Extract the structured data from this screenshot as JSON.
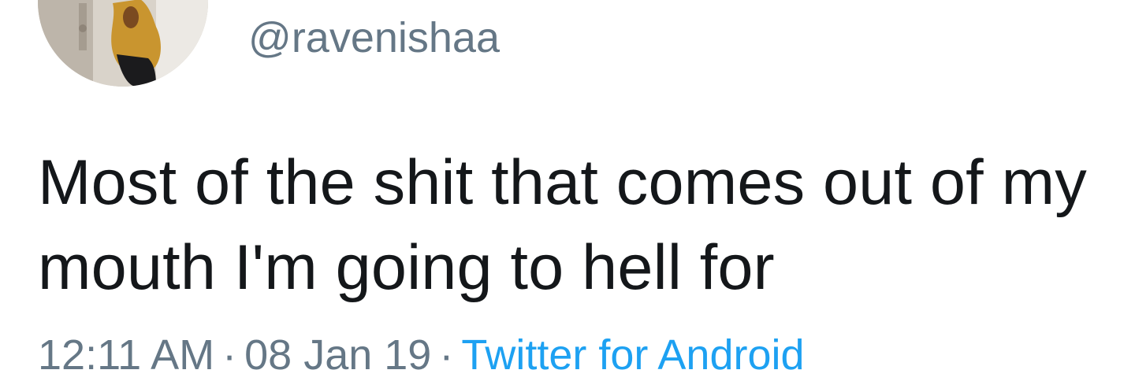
{
  "tweet": {
    "handle": "@ravenishaa",
    "text": "Most of the shit that comes out of my mouth I'm going to hell for",
    "time": "12:11 AM",
    "separator": "·",
    "date": "08 Jan 19",
    "source": "Twitter for Android"
  },
  "colors": {
    "text": "#14171a",
    "muted": "#657786",
    "link": "#1da1f2"
  }
}
